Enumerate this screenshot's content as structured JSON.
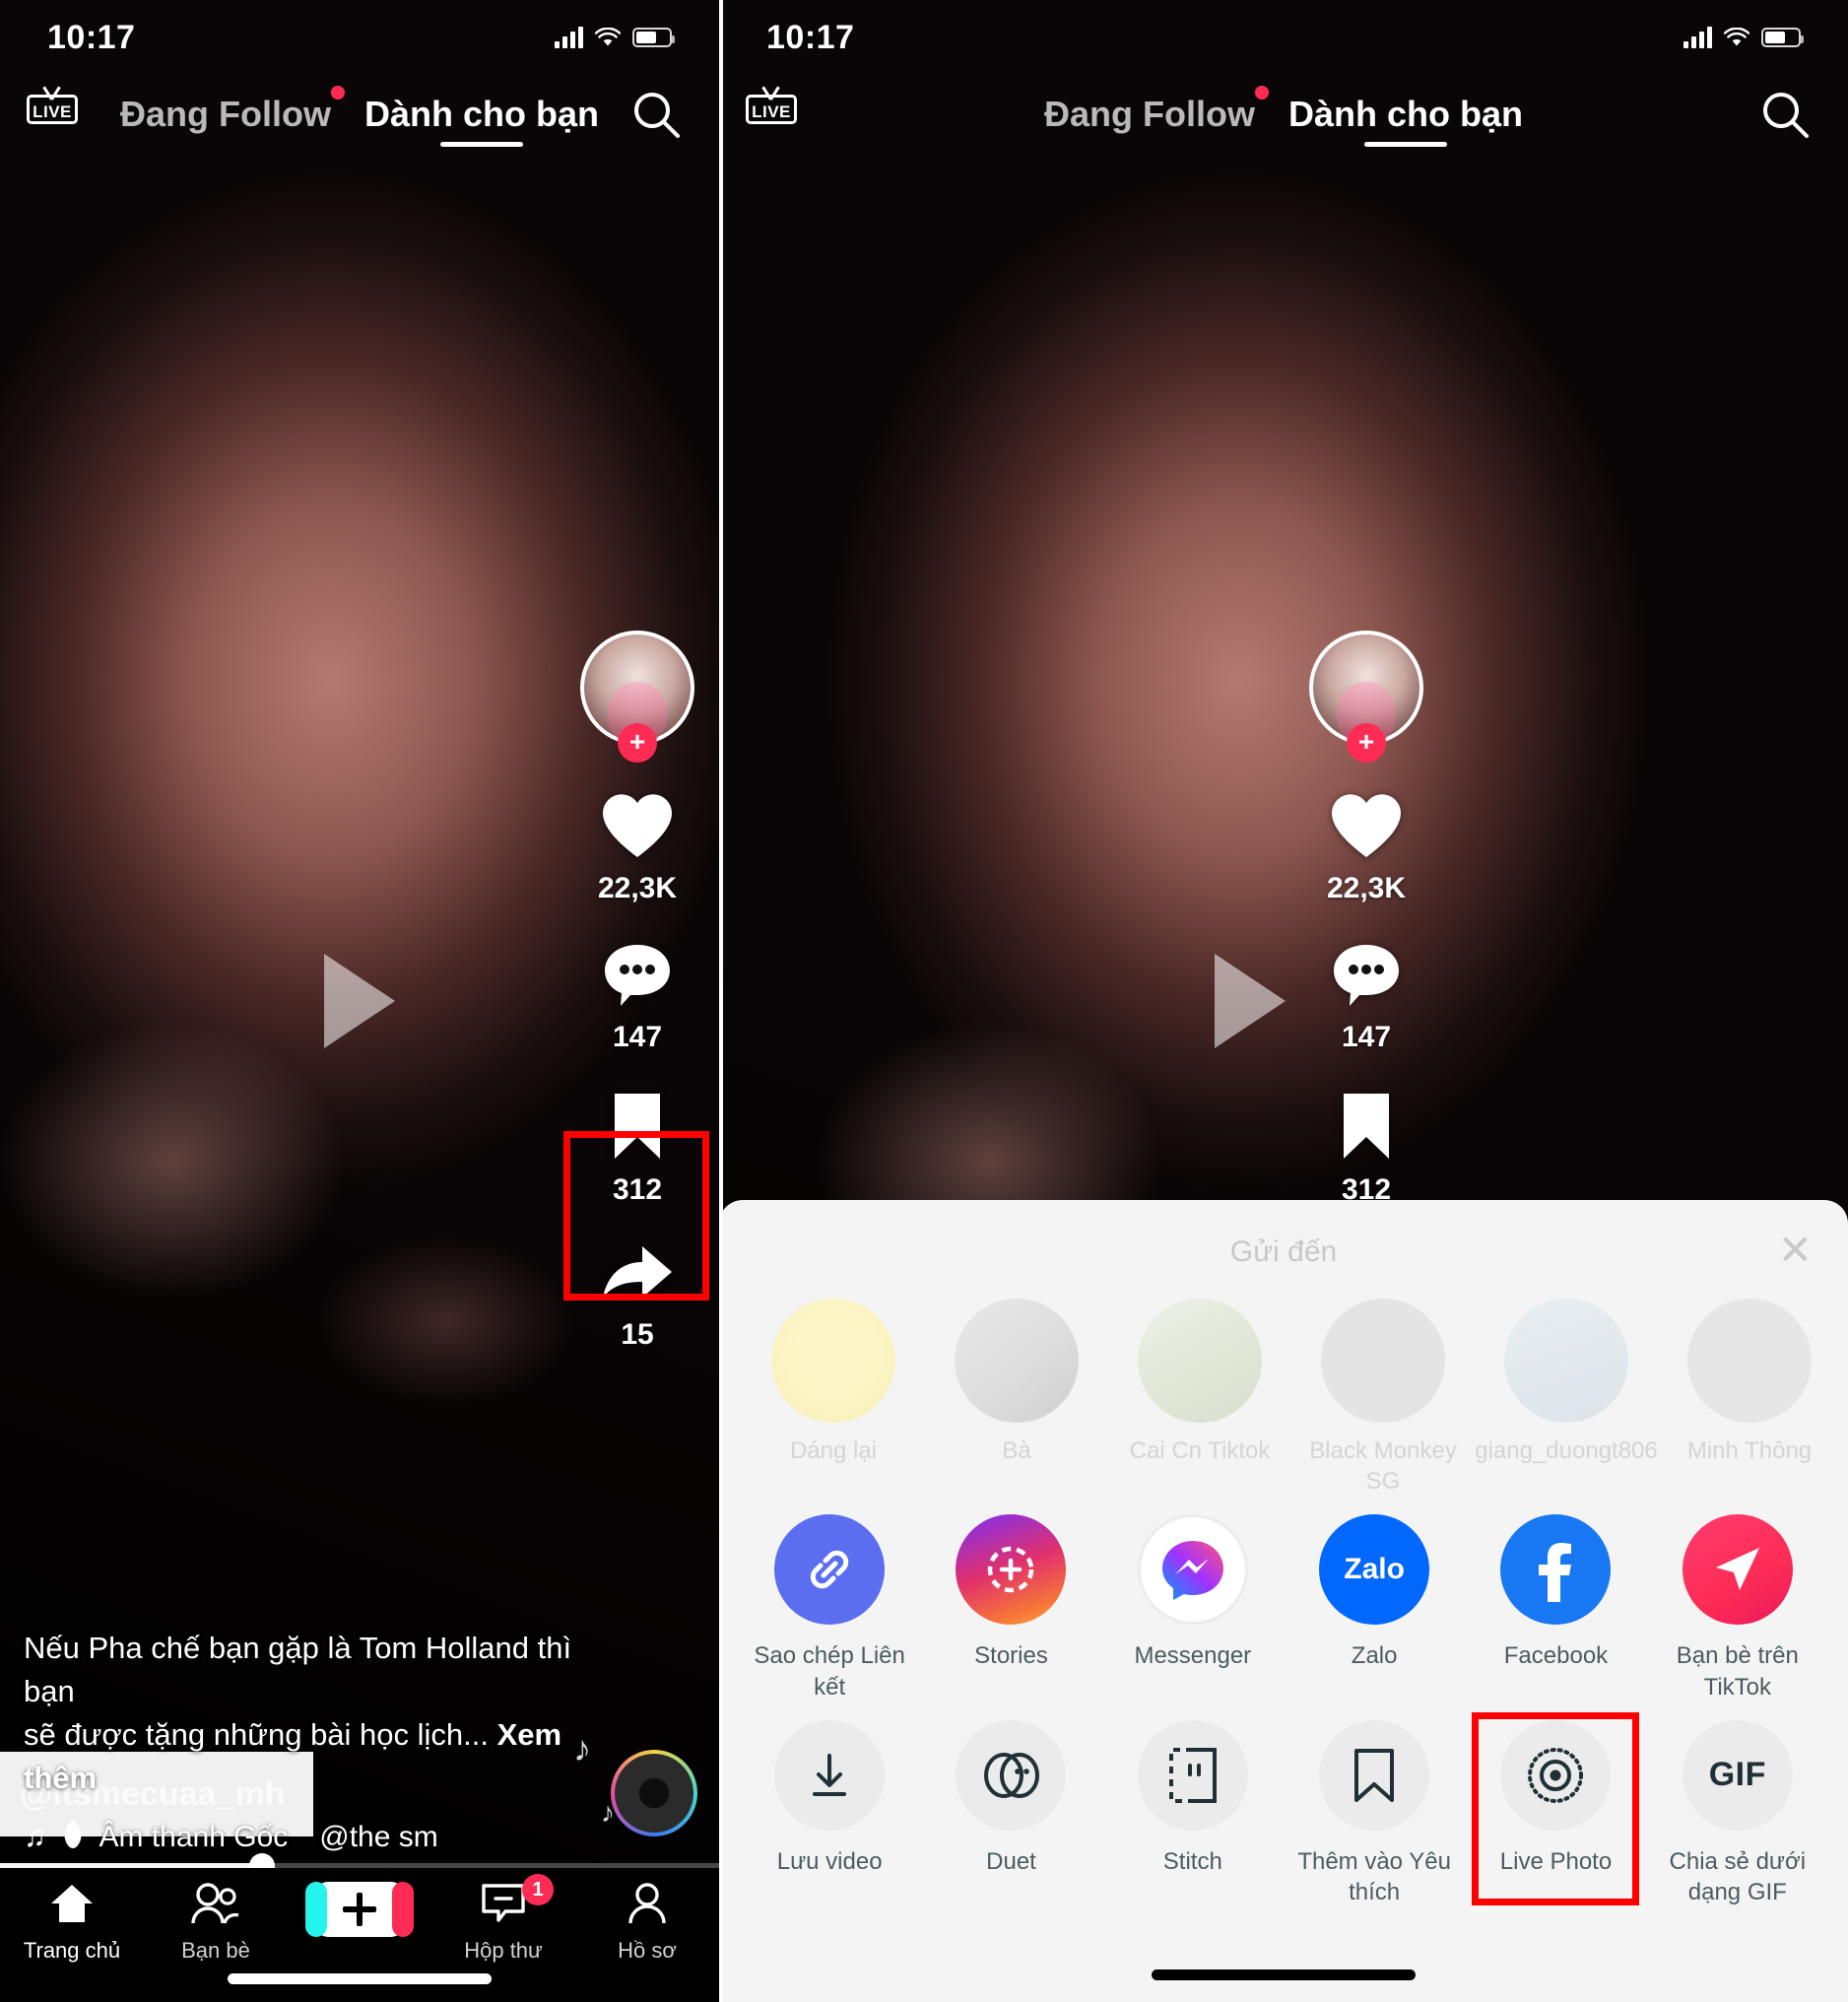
{
  "status_bar": {
    "time": "10:17",
    "battery_level": "64"
  },
  "top_nav": {
    "live_label": "LIVE",
    "tabs": [
      {
        "label": "Đang Follow",
        "active": false,
        "has_dot": true
      },
      {
        "label": "Dành cho bạn",
        "active": true,
        "has_dot": false
      }
    ],
    "search_icon": "search-icon"
  },
  "video": {
    "handle": "@itsmecuaa_mh",
    "caption_line1": "Nếu Pha chế bạn gặp là Tom Holland thì bạn",
    "caption_line2": "sẽ được tặng những bài học lịch...",
    "see_more": "Xem thêm",
    "music_label": "Âm thanh Gốc",
    "music_author": "@the sm",
    "progress_percent": "36.5"
  },
  "action_rail": {
    "follow_plus": "+",
    "like_count": "22,3K",
    "comment_count": "147",
    "bookmark_count": "312",
    "share_count": "15"
  },
  "tab_bar": {
    "items": [
      {
        "label": "Trang chủ",
        "icon": "home-icon",
        "badge": ""
      },
      {
        "label": "Bạn bè",
        "icon": "friends-icon",
        "badge": ""
      },
      {
        "label": "",
        "icon": "create-icon",
        "badge": ""
      },
      {
        "label": "Hộp thư",
        "icon": "inbox-icon",
        "badge": "1"
      },
      {
        "label": "Hồ sơ",
        "icon": "profile-icon",
        "badge": ""
      }
    ]
  },
  "share_sheet": {
    "title": "Gửi đến",
    "close_icon": "close-icon",
    "contacts": [
      {
        "name": "Dáng lại"
      },
      {
        "name": "Bà"
      },
      {
        "name": "Cai Cn Tiktok"
      },
      {
        "name": "Black Monkey SG"
      },
      {
        "name": "giang_duongt806"
      },
      {
        "name": "Minh Thông"
      }
    ],
    "apps": [
      {
        "label": "Sao chép Liên kết",
        "icon": "link-icon",
        "color": "#5b6ef0"
      },
      {
        "label": "Stories",
        "icon": "instagram-stories-icon",
        "color": "#e1306c"
      },
      {
        "label": "Messenger",
        "icon": "messenger-icon",
        "color": "#a334fa"
      },
      {
        "label": "Zalo",
        "icon": "zalo-icon",
        "color": "#0068ff"
      },
      {
        "label": "Facebook",
        "icon": "facebook-icon",
        "color": "#1877f2"
      },
      {
        "label": "Bạn bè trên TikTok",
        "icon": "tiktok-friends-icon",
        "color": "#fe2c55"
      }
    ],
    "actions": [
      {
        "label": "Lưu video",
        "icon": "download-icon",
        "highlighted": false
      },
      {
        "label": "Duet",
        "icon": "duet-icon",
        "highlighted": false
      },
      {
        "label": "Stitch",
        "icon": "stitch-icon",
        "highlighted": false
      },
      {
        "label": "Thêm vào Yêu thích",
        "icon": "bookmark-icon",
        "highlighted": false
      },
      {
        "label": "Live Photo",
        "icon": "live-photo-icon",
        "highlighted": true
      },
      {
        "label": "Chia sẻ dưới dạng GIF",
        "icon": "gif-icon",
        "highlighted": false
      }
    ],
    "gif_text": "GIF",
    "zalo_text": "Zalo"
  },
  "highlight_color": "#ff0000"
}
